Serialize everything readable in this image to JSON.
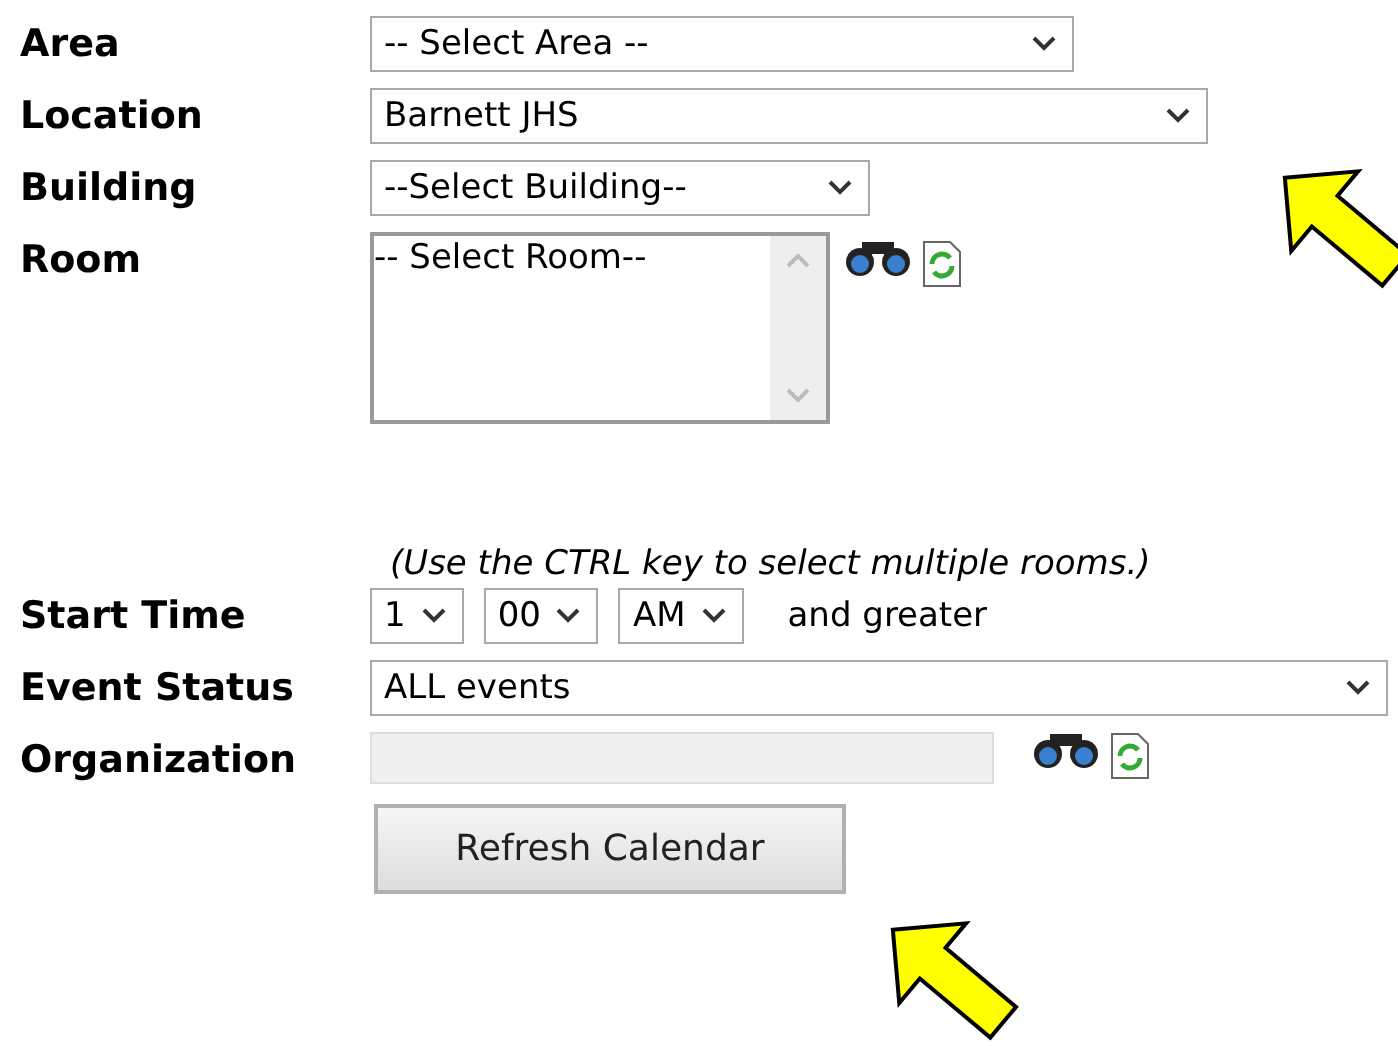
{
  "form_top": [
    {
      "kind": "select",
      "label": "Area",
      "value": "-- Select Area --"
    },
    {
      "kind": "select",
      "label": "Location",
      "value": "Barnett JHS"
    },
    {
      "kind": "select",
      "label": "Building",
      "value": "--Select Building--"
    },
    {
      "kind": "listbox",
      "label": "Room",
      "value": "-- Select Room--"
    }
  ],
  "hint": "(Use the CTRL key to select multiple rooms.)",
  "form_bottom": [
    {
      "kind": "time",
      "label": "Start Time",
      "parts": [
        "1",
        "00",
        "AM"
      ],
      "suffix": "and greater"
    },
    {
      "kind": "select",
      "label": "Event Status",
      "value": "ALL events"
    },
    {
      "kind": "text",
      "label": "Organization",
      "disabled": true
    }
  ],
  "button": "Refresh Calendar"
}
